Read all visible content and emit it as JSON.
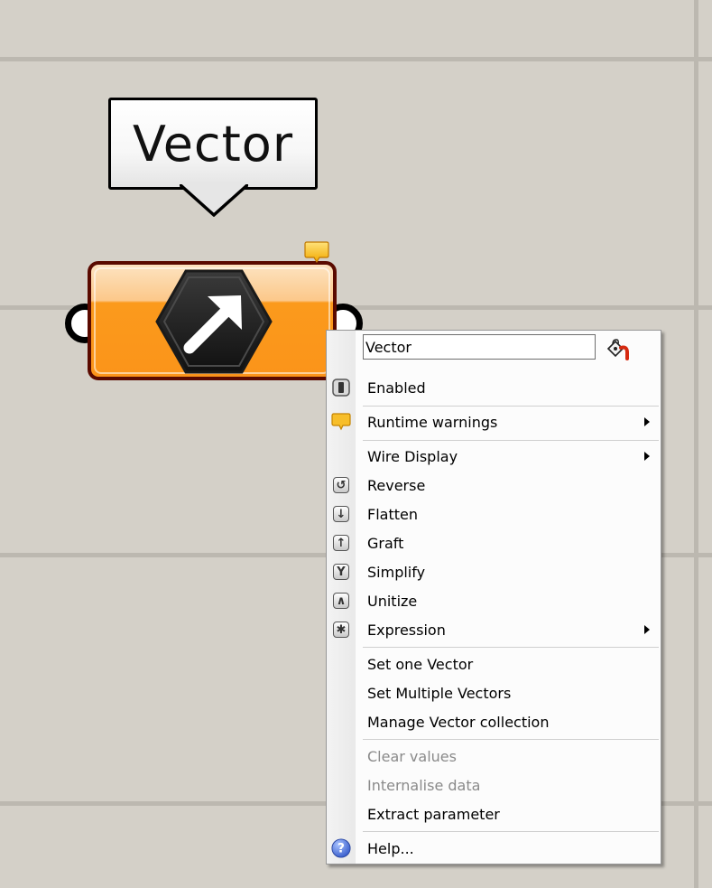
{
  "canvas": {
    "background": "#d4d0c8",
    "gridline_color": "#bcb8b0"
  },
  "tooltip": {
    "text": "Vector"
  },
  "component": {
    "name": "Vector",
    "icon": "vector-arrow-hexagon-icon",
    "fill_color": "#fb941a",
    "border_color": "#5a0a00",
    "warning_flag": "runtime-warning-icon"
  },
  "menu": {
    "name_field": {
      "value": "Vector"
    },
    "paint_icon": "paint-bucket-icon",
    "items": [
      {
        "label": "Enabled",
        "icon": "toggle-switch-icon",
        "enabled": true
      },
      {
        "label": "Runtime warnings",
        "icon": "warning-balloon-icon",
        "submenu": true,
        "enabled": true
      },
      {
        "label": "Wire Display",
        "icon": "",
        "submenu": true,
        "enabled": true
      },
      {
        "label": "Reverse",
        "icon": "reverse-icon",
        "enabled": true
      },
      {
        "label": "Flatten",
        "icon": "flatten-icon",
        "enabled": true
      },
      {
        "label": "Graft",
        "icon": "graft-icon",
        "enabled": true
      },
      {
        "label": "Simplify",
        "icon": "simplify-icon",
        "enabled": true
      },
      {
        "label": "Unitize",
        "icon": "unitize-icon",
        "enabled": true
      },
      {
        "label": "Expression",
        "icon": "expression-icon",
        "submenu": true,
        "enabled": true
      },
      {
        "label": "Set one Vector",
        "icon": "",
        "enabled": true
      },
      {
        "label": "Set Multiple Vectors",
        "icon": "",
        "enabled": true
      },
      {
        "label": "Manage Vector collection",
        "icon": "",
        "enabled": true
      },
      {
        "label": "Clear values",
        "icon": "",
        "enabled": false
      },
      {
        "label": "Internalise data",
        "icon": "",
        "enabled": false
      },
      {
        "label": "Extract parameter",
        "icon": "",
        "enabled": true
      },
      {
        "label": "Help...",
        "icon": "help-icon",
        "enabled": true
      }
    ]
  }
}
